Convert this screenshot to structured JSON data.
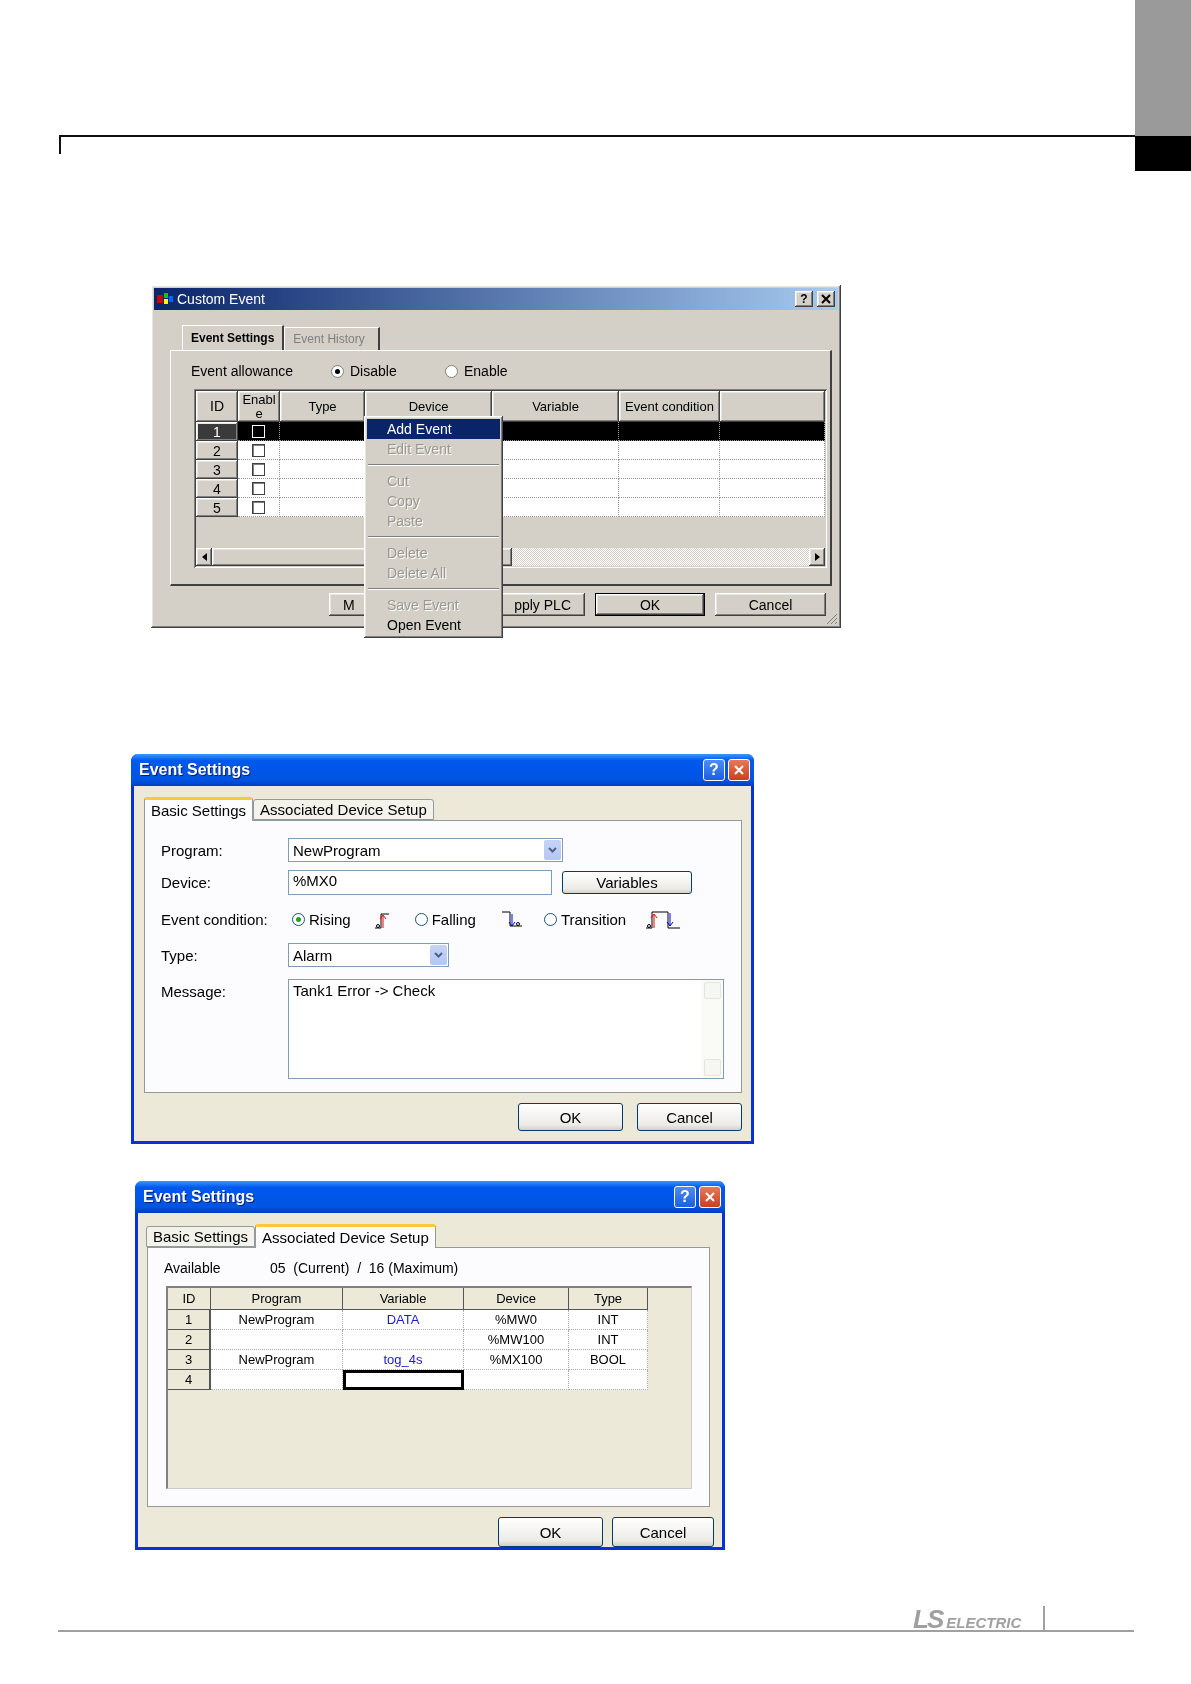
{
  "custom_event": {
    "title": "Custom Event",
    "help": "?",
    "tabs": [
      {
        "label": "Event Settings",
        "selected": true
      },
      {
        "label": "Event History",
        "selected": false
      }
    ],
    "event_allowance": {
      "label": "Event allowance",
      "options": [
        {
          "label": "Disable",
          "selected": true
        },
        {
          "label": "Enable",
          "selected": false
        }
      ]
    },
    "table": {
      "columns": [
        "ID",
        "Enable",
        "Type",
        "Device",
        "Variable",
        "Event condition"
      ],
      "rows": [
        {
          "id": "1",
          "enabled": false,
          "selected": true
        },
        {
          "id": "2",
          "enabled": false,
          "selected": false
        },
        {
          "id": "3",
          "enabled": false,
          "selected": false
        },
        {
          "id": "4",
          "enabled": false,
          "selected": false
        },
        {
          "id": "5",
          "enabled": false,
          "selected": false
        }
      ]
    },
    "buttons": [
      "M",
      "pply PLC",
      "OK",
      "Cancel"
    ],
    "context_menu": [
      {
        "kind": "item",
        "label": "Add Event",
        "selected": true,
        "disabled": false
      },
      {
        "kind": "item",
        "label": "Edit Event",
        "selected": false,
        "disabled": true
      },
      {
        "kind": "separator"
      },
      {
        "kind": "item",
        "label": "Cut",
        "selected": false,
        "disabled": true
      },
      {
        "kind": "item",
        "label": "Copy",
        "selected": false,
        "disabled": true
      },
      {
        "kind": "item",
        "label": "Paste",
        "selected": false,
        "disabled": true
      },
      {
        "kind": "separator"
      },
      {
        "kind": "item",
        "label": "Delete",
        "selected": false,
        "disabled": true
      },
      {
        "kind": "item",
        "label": "Delete All",
        "selected": false,
        "disabled": true
      },
      {
        "kind": "separator"
      },
      {
        "kind": "item",
        "label": "Save Event",
        "selected": false,
        "disabled": true
      },
      {
        "kind": "item",
        "label": "Open Event",
        "selected": false,
        "disabled": false
      }
    ]
  },
  "basic_settings_dialog": {
    "title": "Event Settings",
    "help": "?",
    "tabs": [
      {
        "label": "Basic Settings",
        "selected": true
      },
      {
        "label": "Associated Device Setup",
        "selected": false
      }
    ],
    "program": {
      "label": "Program:",
      "value": "NewProgram"
    },
    "device": {
      "label": "Device:",
      "value": "%MX0"
    },
    "variables_button": "Variables",
    "event_condition": {
      "label": "Event condition:",
      "options": [
        {
          "label": "Rising",
          "kind": "rising",
          "selected": true
        },
        {
          "label": "Falling",
          "kind": "falling",
          "selected": false
        },
        {
          "label": "Transition",
          "kind": "transition",
          "selected": false
        }
      ]
    },
    "type": {
      "label": "Type:",
      "value": "Alarm"
    },
    "message": {
      "label": "Message:",
      "value": "Tank1 Error -> Check"
    },
    "buttons": [
      "OK",
      "Cancel"
    ]
  },
  "device_setup_dialog": {
    "title": "Event Settings",
    "help": "?",
    "tabs": [
      {
        "label": "Basic Settings",
        "selected": false
      },
      {
        "label": "Associated Device Setup",
        "selected": true
      }
    ],
    "available": {
      "label": "Available",
      "value": "05  (Current)  /  16 (Maximum)"
    },
    "table": {
      "columns": [
        "ID",
        "Program",
        "Variable",
        "Device",
        "Type"
      ],
      "rows": [
        {
          "id": "1",
          "program": "NewProgram",
          "variable": "DATA",
          "device": "%MW0",
          "type": "INT",
          "focused": false
        },
        {
          "id": "2",
          "device": "%MW100",
          "type": "INT",
          "focused": false
        },
        {
          "id": "3",
          "program": "NewProgram",
          "variable": "tog_4s",
          "device": "%MX100",
          "type": "BOOL",
          "focused": false
        },
        {
          "id": "4",
          "focused": true
        }
      ]
    },
    "buttons": [
      "OK",
      "Cancel"
    ]
  },
  "footer": {
    "logo_mark": "LS",
    "logo_word": "ELECTRIC"
  }
}
